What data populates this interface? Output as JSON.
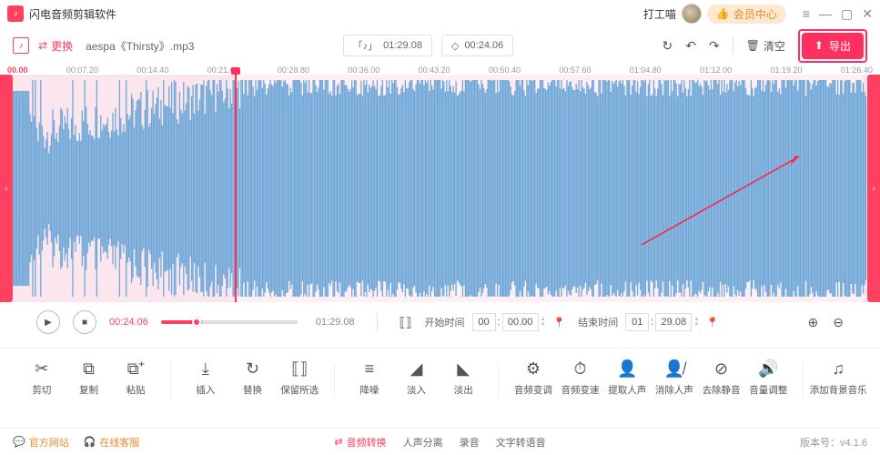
{
  "titlebar": {
    "app_name": "闪电音频剪辑软件",
    "user_label": "打工喵",
    "member_btn": "会员中心"
  },
  "toolbar": {
    "swap_label": "更换",
    "file_name": "aespa《Thirsty》.mp3",
    "total_duration_chip": "01:29.08",
    "cursor_time_chip": "00:24.06",
    "clear_label": "清空",
    "export_label": "导出"
  },
  "ruler": {
    "ticks": [
      "00.00",
      "00:07.20",
      "00:14.40",
      "00:21.60",
      "00:28.80",
      "00:36.00",
      "00:43.20",
      "00:50.40",
      "00:57.60",
      "01:04.80",
      "01:12.00",
      "01:19.20",
      "01:26.40"
    ]
  },
  "transport": {
    "cur_time": "00:24.06",
    "total_time": "01:29.08",
    "start_label": "开始时间",
    "start_mm": "00",
    "start_ss": "00.00",
    "end_label": "结束时间",
    "end_mm": "01",
    "end_ss": "29.08"
  },
  "tools": {
    "group1": [
      {
        "label": "剪切",
        "icon": "✂"
      },
      {
        "label": "复制",
        "icon": "⧉"
      },
      {
        "label": "粘贴",
        "icon": "⧉⁺"
      }
    ],
    "group2": [
      {
        "label": "插入",
        "icon": "⤓"
      },
      {
        "label": "替换",
        "icon": "↻"
      },
      {
        "label": "保留所选",
        "icon": "⟦⟧"
      }
    ],
    "group3": [
      {
        "label": "降噪",
        "icon": "≡"
      },
      {
        "label": "淡入",
        "icon": "◢"
      },
      {
        "label": "淡出",
        "icon": "◣"
      }
    ],
    "group4": [
      {
        "label": "音频变调",
        "icon": "⚙"
      },
      {
        "label": "音频变速",
        "icon": "⏱"
      },
      {
        "label": "提取人声",
        "icon": "👤"
      },
      {
        "label": "消除人声",
        "icon": "👤̸"
      },
      {
        "label": "去除静音",
        "icon": "⊘"
      },
      {
        "label": "音量调整",
        "icon": "🔊"
      }
    ],
    "group5": [
      {
        "label": "添加背景音乐",
        "icon": "♫"
      }
    ]
  },
  "statusbar": {
    "official_site": "官方网站",
    "online_service": "在线客服",
    "audio_convert": "音频转换",
    "voice_separate": "人声分离",
    "record": "录音",
    "tts": "文字转语音",
    "version_label": "版本号：",
    "version": "v4.1.6"
  }
}
